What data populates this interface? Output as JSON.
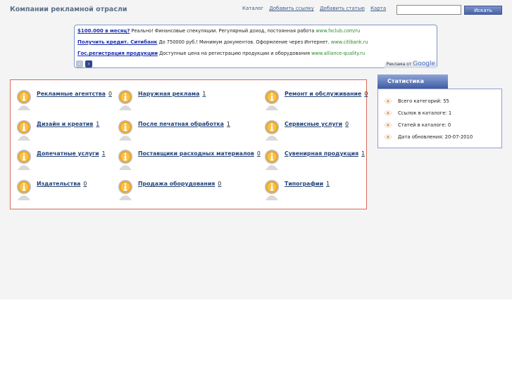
{
  "site": {
    "title": "Компании рекламной отрасли"
  },
  "nav": [
    {
      "label": "Каталог",
      "underline": false
    },
    {
      "label": "Добавить ссылку",
      "underline": true
    },
    {
      "label": "Добавить статью",
      "underline": true
    },
    {
      "label": "Карта",
      "underline": true
    }
  ],
  "search": {
    "value": "",
    "button": "Искать"
  },
  "ads": {
    "items": [
      {
        "title": "$100.000 в месяц?",
        "text": " Реально! Финансовые спекуляции. Регулярный доход, постоянная работа ",
        "url": "www.fxclub.com/ru"
      },
      {
        "title": "Получить кредит. Ситибанк",
        "text": " До 750000 руб.! Минимум документов. Оформление через Интернет. ",
        "url": "www.citibank.ru"
      },
      {
        "title": "Гос.регистрация продукции",
        "text": " Доступные цена на регистрацию продукции и оборудования ",
        "url": "www.alliance-quality.ru"
      }
    ],
    "prev": "‹",
    "next": "›",
    "google_prefix": "Реклама от ",
    "google_brand": "Google"
  },
  "categories": [
    {
      "label": "Рекламные агентства",
      "count": "0"
    },
    {
      "label": "Наружная реклама",
      "count": "1"
    },
    {
      "label": "Ремонт и обслуживание",
      "count": "0"
    },
    {
      "label": "Дизайн и креатив",
      "count": "1"
    },
    {
      "label": "После печатная обработка",
      "count": "1"
    },
    {
      "label": "Сервисные услуги",
      "count": "0"
    },
    {
      "label": "Допечатные услуги",
      "count": "1"
    },
    {
      "label": "Поставщики расходных материалов",
      "count": "0"
    },
    {
      "label": "Сувенирная продукция",
      "count": "1"
    },
    {
      "label": "Издательства",
      "count": "0"
    },
    {
      "label": "Продажа оборудования",
      "count": "0"
    },
    {
      "label": "Типографии",
      "count": "1"
    }
  ],
  "stats": {
    "title": "Статистика",
    "rows": [
      "Всего категорий: 55",
      "Ссылок в каталоге: 1",
      "Статей в каталоге: 0",
      "Дата обновления: 20-07-2010"
    ]
  },
  "colors": {
    "accent": "#4a62a8",
    "catalog_border": "#d96a5a",
    "link": "#23447a"
  }
}
